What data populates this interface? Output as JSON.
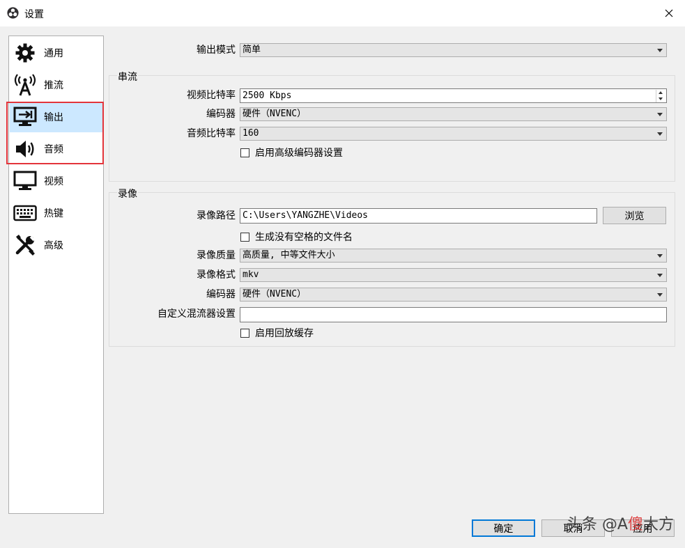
{
  "window": {
    "title": "设置",
    "close_icon": "close-icon",
    "logo_icon": "obs-logo-icon"
  },
  "sidebar": {
    "items": [
      {
        "label": "通用",
        "icon": "gear-icon"
      },
      {
        "label": "推流",
        "icon": "antenna-icon"
      },
      {
        "label": "输出",
        "icon": "output-icon",
        "selected": true
      },
      {
        "label": "音频",
        "icon": "speaker-icon"
      },
      {
        "label": "视频",
        "icon": "monitor-icon"
      },
      {
        "label": "热键",
        "icon": "keyboard-icon"
      },
      {
        "label": "高级",
        "icon": "tools-icon"
      }
    ]
  },
  "output_mode": {
    "label": "输出模式",
    "value": "简单"
  },
  "streaming": {
    "title": "串流",
    "video_bitrate": {
      "label": "视频比特率",
      "value": "2500 Kbps"
    },
    "encoder": {
      "label": "编码器",
      "value": "硬件（NVENC）"
    },
    "audio_bitrate": {
      "label": "音频比特率",
      "value": "160"
    },
    "advanced_encoder_checkbox": {
      "label": "启用高级编码器设置",
      "checked": false
    }
  },
  "recording": {
    "title": "录像",
    "path": {
      "label": "录像路径",
      "value": "C:\\Users\\YANGZHE\\Videos"
    },
    "browse_label": "浏览",
    "no_space_checkbox": {
      "label": "生成没有空格的文件名",
      "checked": false
    },
    "quality": {
      "label": "录像质量",
      "value": "高质量, 中等文件大小"
    },
    "format": {
      "label": "录像格式",
      "value": "mkv"
    },
    "encoder": {
      "label": "编码器",
      "value": "硬件（NVENC）"
    },
    "muxer": {
      "label": "自定义混流器设置",
      "value": ""
    },
    "replay_buffer_checkbox": {
      "label": "启用回放缓存",
      "checked": false
    }
  },
  "footer": {
    "ok_label": "确定",
    "cancel_label": "取消",
    "apply_label": "应用"
  },
  "watermark": {
    "text_a": "头条 @A",
    "text_b": "傻",
    "text_c": "大方"
  },
  "colors": {
    "selection": "#cce8ff",
    "highlight_box": "#e3343a",
    "primary_border": "#0078d7"
  }
}
